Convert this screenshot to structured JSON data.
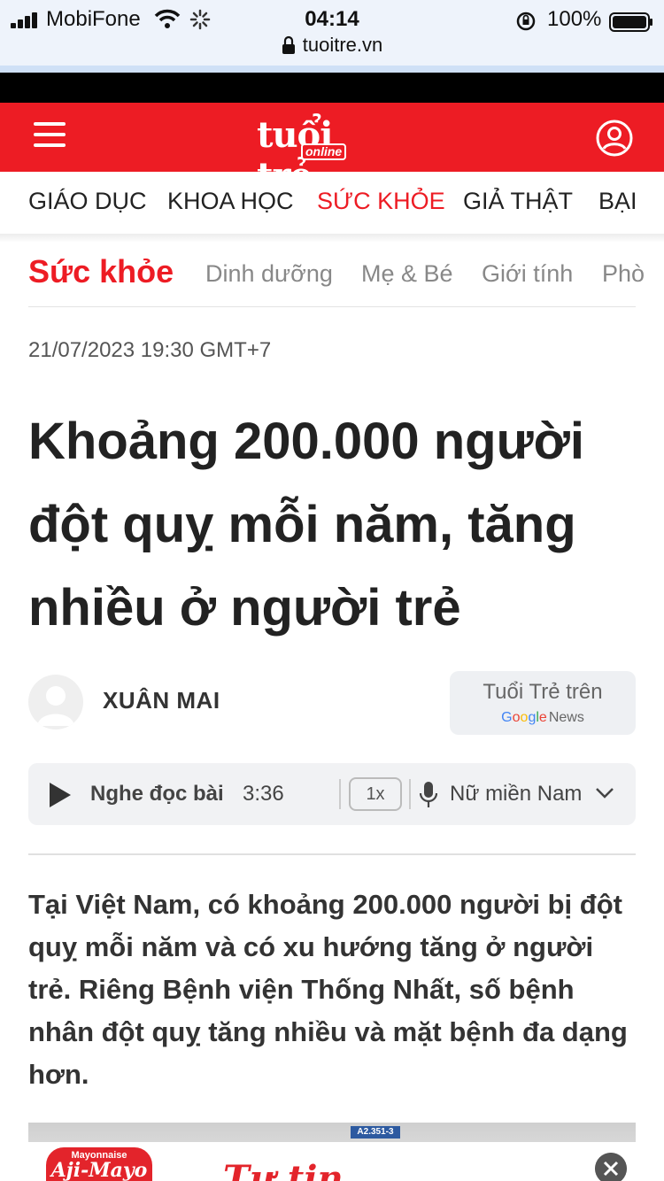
{
  "status_bar": {
    "carrier": "MobiFone",
    "time": "04:14",
    "battery": "100%",
    "url": "tuoitre.vn"
  },
  "header": {
    "logo_main": "tuổi trẻ",
    "logo_sub": "online",
    "brand_color": "#ed1c24"
  },
  "categories": [
    {
      "label": "GIÁO DỤC",
      "active": false
    },
    {
      "label": "KHOA HỌC",
      "active": false
    },
    {
      "label": "SỨC KHỎE",
      "active": true
    },
    {
      "label": "GIẢ THẬT",
      "active": false
    },
    {
      "label": "BẠI",
      "active": false
    }
  ],
  "section": {
    "title": "Sức khỏe",
    "subcategories": [
      "Dinh dưỡng",
      "Mẹ & Bé",
      "Giới tính",
      "Phò"
    ]
  },
  "article": {
    "date": "21/07/2023 19:30 GMT+7",
    "headline": "Khoảng 200.000 người đột quỵ mỗi năm, tăng nhiều ở người trẻ",
    "author": "XUÂN MAI",
    "lead": "Tại Việt Nam, có khoảng 200.000 người bị đột quỵ mỗi năm và có xu hướng tăng ở người trẻ. Riêng Bệnh viện Thống Nhất, số bệnh nhân đột quỵ tăng nhiều và mặt bệnh đa dạng hơn.",
    "image_plate": "A2.351-3"
  },
  "google_news": {
    "top": "Tuổi Trẻ trên",
    "g1": "G",
    "g2": "o",
    "g3": "o",
    "g4": "g",
    "g5": "l",
    "g6": "e",
    "news": "News"
  },
  "player": {
    "label": "Nghe đọc bài",
    "duration": "3:36",
    "speed": "1x",
    "voice": "Nữ miền Nam"
  },
  "ad": {
    "brand_top": "Mayonnaise",
    "brand_main": "Aji-Mayo",
    "script": "Tự tin"
  }
}
